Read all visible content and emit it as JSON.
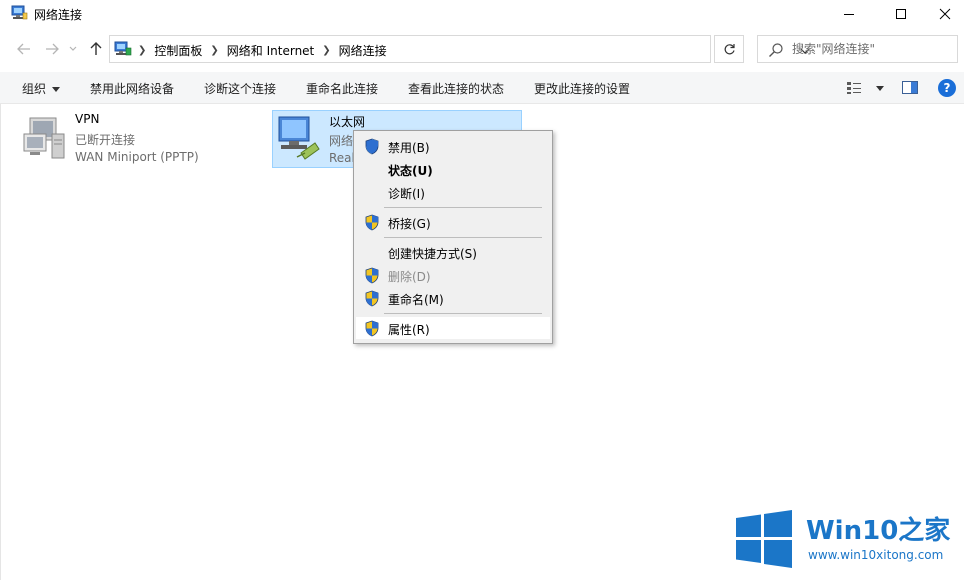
{
  "window": {
    "title": "网络连接"
  },
  "address": {
    "crumbs": [
      "控制面板",
      "网络和 Internet",
      "网络连接"
    ]
  },
  "search": {
    "placeholder": "搜索\"网络连接\""
  },
  "commands": {
    "organize": "组织",
    "disable_device": "禁用此网络设备",
    "diagnose": "诊断这个连接",
    "rename": "重命名此连接",
    "view_status": "查看此连接的状态",
    "change_settings": "更改此连接的设置"
  },
  "connections": [
    {
      "name": "VPN",
      "status": "已断开连接",
      "device": "WAN Miniport (PPTP)"
    },
    {
      "name": "以太网",
      "status": "网络",
      "device": "Real"
    }
  ],
  "context_menu": [
    {
      "label": "禁用(B)",
      "shield": true
    },
    {
      "label": "状态(U)",
      "shield": false,
      "bold": true
    },
    {
      "label": "诊断(I)",
      "shield": false
    },
    {
      "label": "桥接(G)",
      "shield": true
    },
    {
      "label": "创建快捷方式(S)",
      "shield": false
    },
    {
      "label": "删除(D)",
      "shield": true,
      "disabled": true
    },
    {
      "label": "重命名(M)",
      "shield": true
    },
    {
      "label": "属性(R)",
      "shield": true,
      "highlighted": true
    }
  ],
  "watermark": {
    "title_a": "Win10",
    "title_b": "之家",
    "url": "www.win10xitong.com"
  },
  "colors": {
    "selection": "#cce8ff",
    "selection_border": "#99d1ff",
    "menu_bg": "#f0f0f0",
    "watermark_blue": "#1b76c8",
    "help_blue": "#1a6ed8"
  },
  "icons": [
    "network-connections-icon",
    "back-arrow-icon",
    "forward-arrow-icon",
    "up-arrow-icon",
    "refresh-icon",
    "search-icon",
    "view-options-icon",
    "preview-pane-icon",
    "help-icon",
    "uac-shield-icon",
    "computer-network-icon"
  ]
}
